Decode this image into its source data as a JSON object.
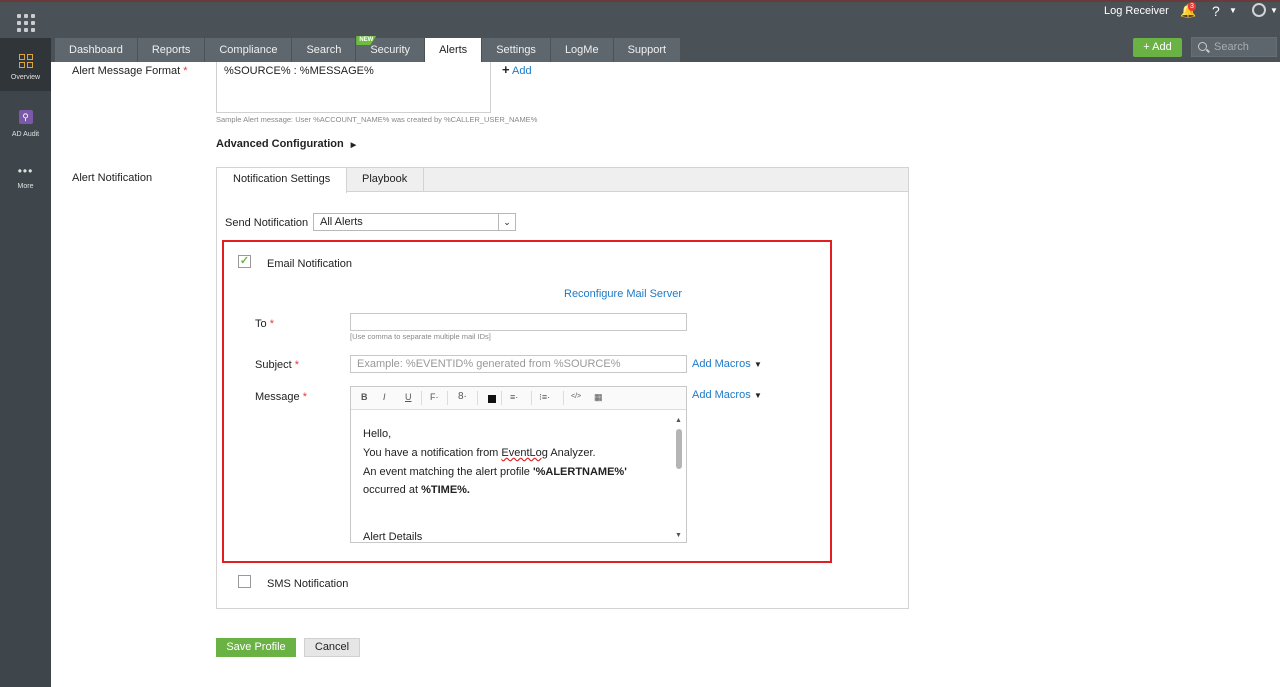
{
  "header": {
    "app_launcher_icon": "apps-grid-icon",
    "log_receiver": "Log Receiver",
    "notification_count": "3",
    "help": "?",
    "add_button": "Add",
    "search_placeholder": "Search"
  },
  "tabs": [
    {
      "label": "Dashboard",
      "active": false
    },
    {
      "label": "Reports",
      "active": false
    },
    {
      "label": "Compliance",
      "active": false
    },
    {
      "label": "Search",
      "active": false
    },
    {
      "label": "Security",
      "active": false,
      "badge": "NEW"
    },
    {
      "label": "Alerts",
      "active": true
    },
    {
      "label": "Settings",
      "active": false
    },
    {
      "label": "LogMe",
      "active": false
    },
    {
      "label": "Support",
      "active": false
    }
  ],
  "sidebar": {
    "items": [
      {
        "label": "Overview",
        "icon": "overview-icon",
        "active": true
      },
      {
        "label": "AD Audit",
        "icon": "ad-audit-icon",
        "active": false
      },
      {
        "label": "More",
        "icon": "more-icon",
        "active": false
      }
    ]
  },
  "form": {
    "alert_message_format_label": "Alert Message Format",
    "alert_message_format_value": "%SOURCE% : %MESSAGE%",
    "add_link": "Add",
    "sample_message": "Sample Alert message: User %ACCOUNT_NAME% was created by %CALLER_USER_NAME%",
    "advanced_configuration": "Advanced Configuration",
    "alert_notification_label": "Alert Notification",
    "required_marker": "*"
  },
  "notification": {
    "tabs": [
      "Notification Settings",
      "Playbook"
    ],
    "send_notification_label": "Send Notification",
    "send_notification_value": "All Alerts",
    "email": {
      "checked": true,
      "label": "Email Notification",
      "reconfigure_link": "Reconfigure Mail Server",
      "to_label": "To",
      "to_value": "",
      "to_hint": "[Use comma to separate multiple mail IDs]",
      "subject_label": "Subject",
      "subject_placeholder": "Example: %EVENTID% generated from %SOURCE%",
      "add_macros": "Add Macros",
      "message_label": "Message",
      "toolbar": {
        "bold": "B",
        "italic": "I",
        "underline": "U",
        "font": "F·",
        "size": "8·",
        "align": "≡·",
        "list": "⁝≡·",
        "code": "</>",
        "table": "▦"
      },
      "body": {
        "line1": "Hello,",
        "line2_pre": "You have a notification from ",
        "line2_word": "EventLog",
        "line2_post": " Analyzer.",
        "line3_pre": "An event matching the alert profile ",
        "line3_bold": "'%ALERTNAME%'",
        "line4_pre": "occurred at ",
        "line4_bold": "%TIME%.",
        "line5": "Alert Details"
      }
    },
    "sms": {
      "checked": false,
      "label": "SMS Notification"
    }
  },
  "actions": {
    "save": "Save Profile",
    "cancel": "Cancel"
  },
  "colors": {
    "accent_green": "#6ab244",
    "link_blue": "#1e7ac7",
    "highlight_red": "#e02020",
    "topbar": "#4a5258"
  }
}
